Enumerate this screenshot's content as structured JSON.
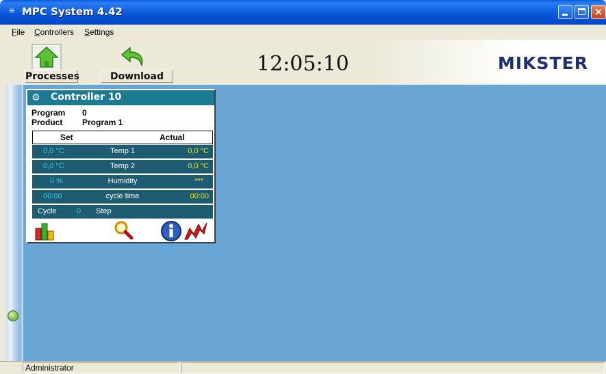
{
  "window": {
    "title": "MPC System 4.42",
    "icon": "mpc-app-icon",
    "controls": {
      "minimize": "minimize-icon",
      "maximize": "maximize-icon",
      "close": "×"
    }
  },
  "menu": [
    "File",
    "Controllers",
    "Settings"
  ],
  "toolbar": {
    "processes_label": "Processes",
    "download_label": "Download",
    "clock": "12:05:10",
    "logo_text": "MIKSTER"
  },
  "controller": {
    "title": "Controller 10",
    "program_label": "Program",
    "program_value": "0",
    "product_label": "Product",
    "product_value": "Program 1",
    "set_header": "Set",
    "actual_header": "Actual",
    "rows": [
      {
        "set": "0,0 °C",
        "name": "Temp 1",
        "actual": "0,0 °C"
      },
      {
        "set": "0,0 °C",
        "name": "Temp 2",
        "actual": "0,0 °C"
      },
      {
        "set": "0 %",
        "name": "Humidity",
        "actual": "***"
      },
      {
        "set": "00:00",
        "name": "cycle time",
        "actual": "00:00"
      }
    ],
    "cycle_label": "Cycle",
    "cycle_value": "0",
    "step_label": "Step",
    "icons": [
      "bar-chart-icon",
      "magnifier-icon",
      "info-icon",
      "chart-line-icon"
    ]
  },
  "status": {
    "user": "Administrator"
  },
  "colors": {
    "titlebar": "#0a58d8",
    "workspace": "#68a6d8",
    "panel_header": "#1c7b92",
    "row_bg": "#1c5b70",
    "set_value": "#38c8ee",
    "actual_value": "#f4e51e"
  }
}
